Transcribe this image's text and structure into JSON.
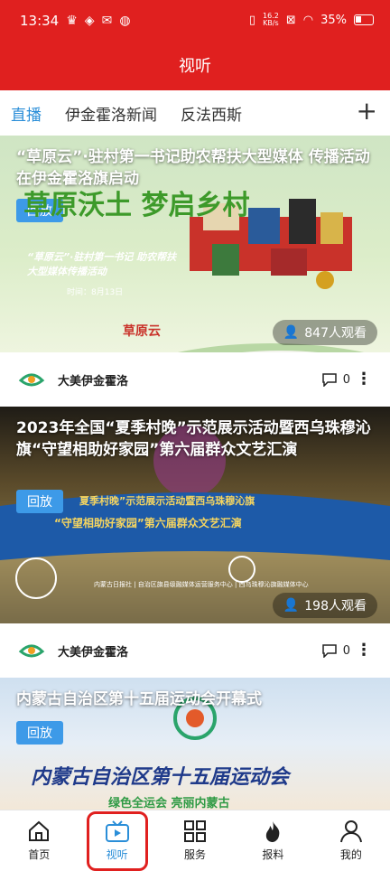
{
  "status": {
    "time": "13:34",
    "net_speed": "16.2",
    "net_unit": "KB/s",
    "battery": "35%"
  },
  "header": {
    "title": "视听"
  },
  "tabs": [
    "直播",
    "伊金霍洛新闻",
    "反法西斯"
  ],
  "feed": [
    {
      "title": "“草原云”·驻村第一书记助农帮扶大型媒体 传播活动在伊金霍洛旗启动",
      "badge": "回放",
      "viewers": "847人观看",
      "poster_big": "草原沃土 梦启乡村",
      "poster_sub": "“草原云”·驻村第一书记 助农帮扶大型媒体传播活动",
      "poster_date": "时间：8月13日",
      "poster_brand": "草原云"
    },
    {
      "title": "2023年全国“夏季村晚”示范展示活动暨西乌珠穆沁旗“守望相助好家园”第六届群众文艺汇演",
      "badge": "回放",
      "viewers": "198人观看",
      "poster_line1": "夏季村晚”示范展示活动暨西乌珠穆沁旗",
      "poster_line2": "“守望相助好家园”第六届群众文艺汇演",
      "poster_footer": "内蒙古日报社 | 自治区旗县级融媒体运营服务中心 | 西乌珠穆沁旗融媒体中心"
    },
    {
      "title": "内蒙古自治区第十五届运动会开幕式",
      "badge": "回放",
      "poster_big": "内蒙古自治区第十五届运动会",
      "poster_sub": "绿色全运会  亮丽内蒙古"
    }
  ],
  "sources": [
    {
      "name": "大美伊金霍洛",
      "comments": "0"
    },
    {
      "name": "大美伊金霍洛",
      "comments": "0"
    }
  ],
  "nav": [
    {
      "label": "首页",
      "icon": "home-icon"
    },
    {
      "label": "视听",
      "icon": "tv-play-icon"
    },
    {
      "label": "服务",
      "icon": "grid-icon"
    },
    {
      "label": "报料",
      "icon": "fire-icon"
    },
    {
      "label": "我的",
      "icon": "user-icon"
    }
  ],
  "colors": {
    "brand_red": "#e0201f",
    "accent_blue": "#2a8ed8",
    "badge_blue": "#3d9ae8"
  }
}
